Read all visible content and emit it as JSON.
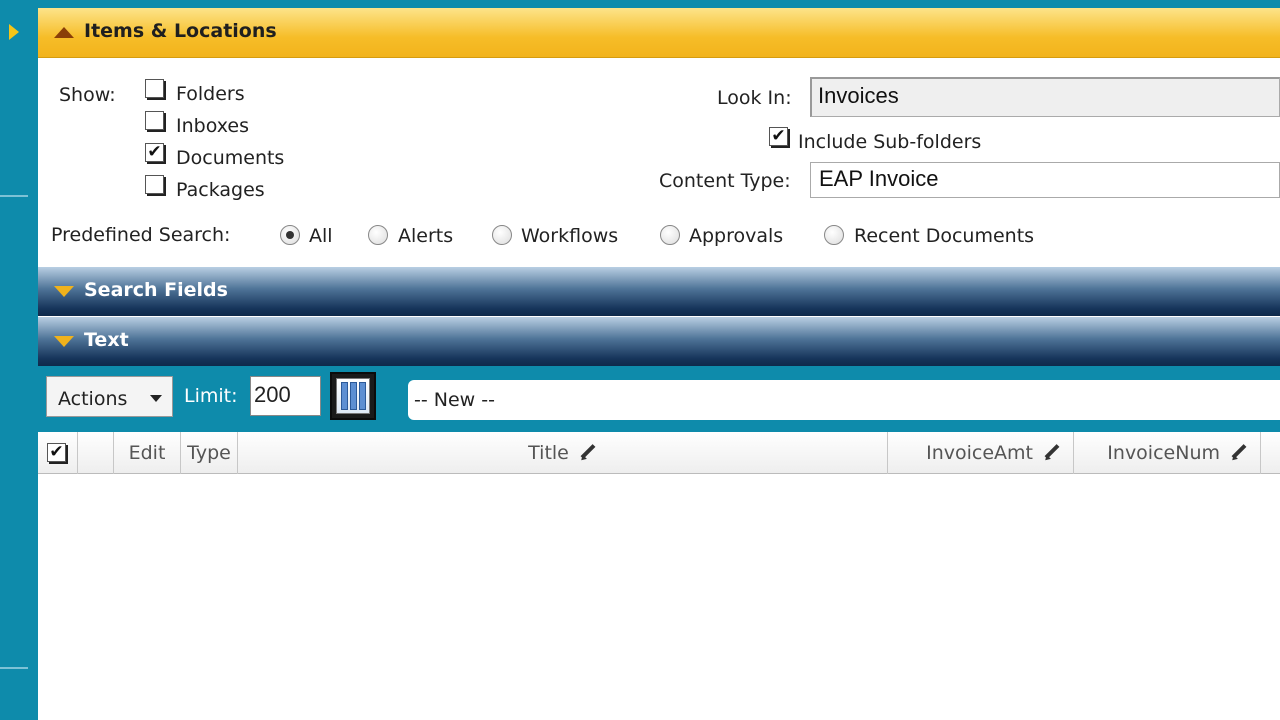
{
  "items_panel": {
    "title": "Items & Locations",
    "show_label": "Show:",
    "show_options": [
      {
        "label": "Folders",
        "checked": false
      },
      {
        "label": "Inboxes",
        "checked": false
      },
      {
        "label": "Documents",
        "checked": true
      },
      {
        "label": "Packages",
        "checked": false
      }
    ],
    "look_in_label": "Look In:",
    "look_in_value": "Invoices",
    "include_subfolders_label": "Include Sub-folders",
    "include_subfolders_checked": true,
    "content_type_label": "Content Type:",
    "content_type_value": "EAP Invoice",
    "predefined_label": "Predefined Search:",
    "predefined_options": [
      {
        "label": "All",
        "selected": true
      },
      {
        "label": "Alerts",
        "selected": false
      },
      {
        "label": "Workflows",
        "selected": false
      },
      {
        "label": "Approvals",
        "selected": false
      },
      {
        "label": "Recent Documents",
        "selected": false
      }
    ]
  },
  "search_fields_bar": {
    "title": "Search Fields"
  },
  "text_bar": {
    "title": "Text"
  },
  "toolbar": {
    "actions_label": "Actions",
    "limit_label": "Limit:",
    "limit_value": "200",
    "new_select_value": "-- New --"
  },
  "grid": {
    "select_all_checked": true,
    "columns": [
      "Edit",
      "Type",
      "Title",
      "InvoiceAmt",
      "InvoiceNum"
    ]
  },
  "icons": {
    "rail_toggle": "play-arrow-icon",
    "collapse": "caret-up-icon",
    "expand": "caret-down-icon",
    "column_chooser": "columns-icon",
    "edit_column": "pencil-icon"
  },
  "colors": {
    "teal": "#0e8bab",
    "gold": "#f6bd28",
    "navy": "#16345a"
  }
}
